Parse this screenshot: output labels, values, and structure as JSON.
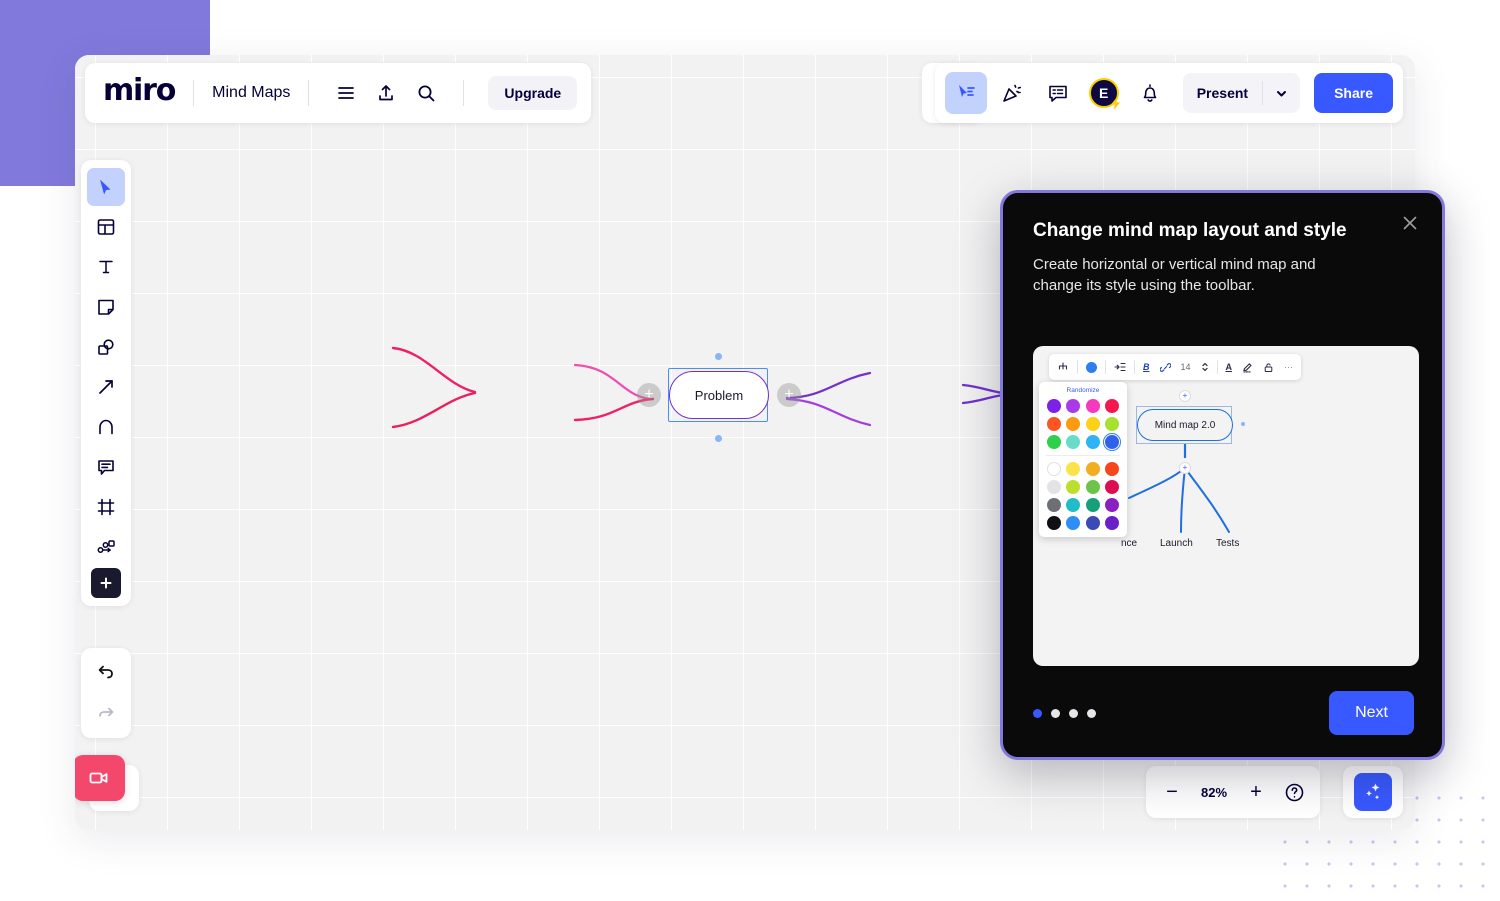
{
  "brand": {
    "logo": "miro",
    "accent": "#3859ff",
    "purple": "#8179DC",
    "pink": "#f4476c"
  },
  "header": {
    "board_title": "Mind Maps",
    "menu_icon": "hamburger-menu-icon",
    "share_export_icon": "upload-icon",
    "search_icon": "search-icon",
    "upgrade_label": "Upgrade"
  },
  "topbar": {
    "templates_icon": "shapes-plus-icon",
    "cursor_icon": "cursor-share-icon",
    "celebrate_icon": "party-popper-icon",
    "comments_icon": "comment-list-icon",
    "avatar_initial": "E",
    "avatar_badge_icon": "lightning-bolt-icon",
    "notifications_icon": "bell-icon",
    "present_label": "Present",
    "present_caret_icon": "chevron-down-icon",
    "share_label": "Share"
  },
  "left_toolbar": {
    "items": [
      {
        "name": "select-tool",
        "icon": "cursor-icon",
        "active": true
      },
      {
        "name": "templates-tool",
        "icon": "template-icon",
        "active": false
      },
      {
        "name": "text-tool",
        "icon": "text-t-icon",
        "active": false
      },
      {
        "name": "sticky-note-tool",
        "icon": "sticky-note-icon",
        "active": false
      },
      {
        "name": "shapes-tool",
        "icon": "shapes-icon",
        "active": false
      },
      {
        "name": "arrow-tool",
        "icon": "arrow-icon",
        "active": false
      },
      {
        "name": "pen-tool",
        "icon": "pen-icon",
        "active": false
      },
      {
        "name": "comment-tool",
        "icon": "comment-icon",
        "active": false
      },
      {
        "name": "frame-tool",
        "icon": "frame-icon",
        "active": false
      },
      {
        "name": "flowchart-tool",
        "icon": "flowchart-icon",
        "active": false
      },
      {
        "name": "more-apps-tool",
        "icon": "plus-icon",
        "active": false
      }
    ],
    "undo_icon": "undo-arrow-icon",
    "redo_icon": "redo-arrow-icon",
    "video_icon": "video-camera-icon"
  },
  "canvas": {
    "node_label": "Problem",
    "node_border_color": "#7130cf",
    "selection_color": "#4f8bf5",
    "branch_colors": {
      "left": "#ef2069",
      "left_light": "#ef4db0",
      "right": "#7130cf",
      "right_light": "#a13ee0"
    },
    "plus_glyph": "+"
  },
  "zoom_bar": {
    "minus_label": "−",
    "level": "82%",
    "plus_label": "+",
    "help_icon": "question-circle-icon",
    "ai_icon": "sparkles-icon"
  },
  "modal": {
    "title": "Change mind map layout and style",
    "subtitle": "Create horizontal or vertical mind map and change its style using the toolbar.",
    "close_icon": "close-x-icon",
    "next_label": "Next",
    "dots_total": 4,
    "dot_active_index": 0,
    "preview": {
      "toolbar": {
        "layout_icon": "mindmap-layout-icon",
        "color_icon": "color-circle-icon",
        "align_icon": "indent-align-icon",
        "bold_label": "B",
        "link_icon": "link-icon",
        "font_size": "14",
        "stepper_icon": "stepper-updown-icon",
        "text_color_label": "A",
        "pen_icon": "pen-icon",
        "lock_icon": "lock-icon",
        "more_label": "···"
      },
      "palette": {
        "randomize_label": "Randomize",
        "row_top": [
          [
            "#7b21e8",
            "#a93ae8",
            "#f53ac0",
            "#f5174f"
          ],
          [
            "#fb5622",
            "#fc9a10",
            "#fad116",
            "#a7e130"
          ],
          [
            "#2ecf4a",
            "#66dcc9",
            "#2eb4f5",
            "#2f62e8"
          ]
        ],
        "row_bottom": [
          [
            "#ffffff",
            "#fae34a",
            "#f2ad22",
            "#f5471b"
          ],
          [
            "#e3e3e5",
            "#bede2e",
            "#6ec44a",
            "#db0f52"
          ],
          [
            "#6e6e76",
            "#21bcc9",
            "#15a079",
            "#8a20bf"
          ],
          [
            "#101014",
            "#2f8ef5",
            "#3a4bb5",
            "#6a1fc9"
          ]
        ],
        "selected_color": "#2f62e8",
        "selected_row": 2,
        "selected_col": 3
      },
      "root_label": "Mind map 2.0",
      "child_labels": [
        "nce",
        "Launch",
        "Tests"
      ]
    }
  }
}
